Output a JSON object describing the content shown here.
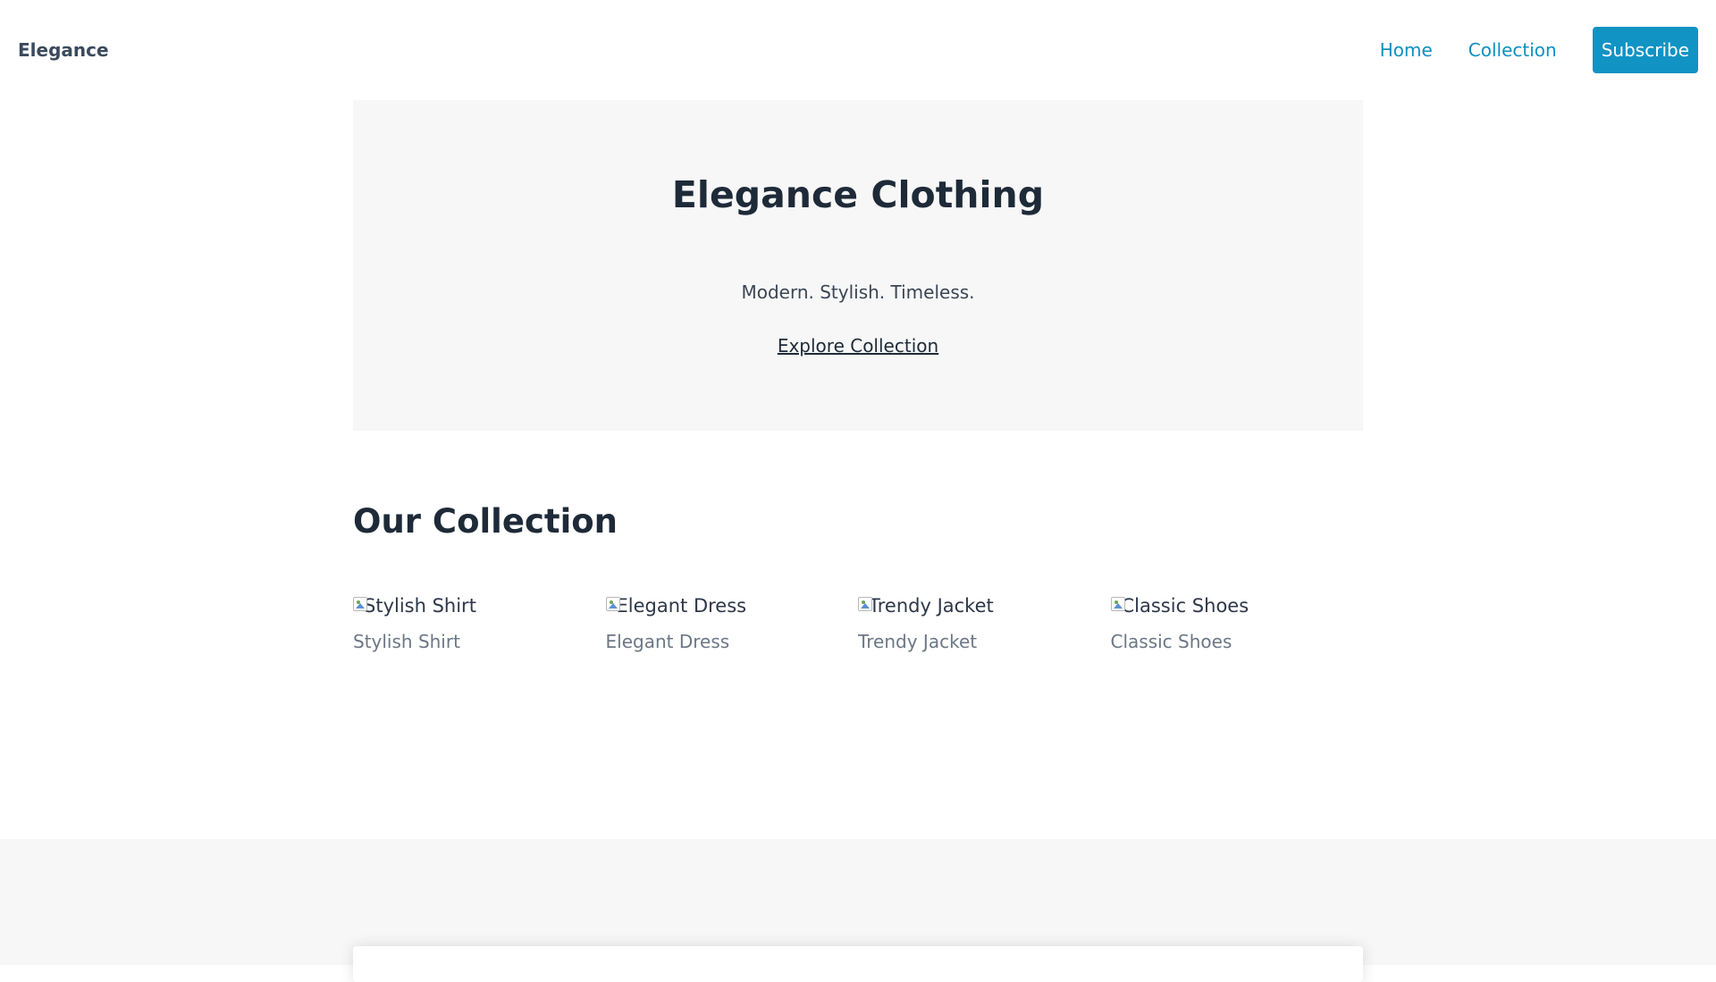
{
  "header": {
    "brand": "Elegance",
    "nav": {
      "home": "Home",
      "collection": "Collection",
      "subscribe": "Subscribe"
    }
  },
  "hero": {
    "title": "Elegance Clothing",
    "tagline": "Modern. Stylish. Timeless.",
    "cta": "Explore Collection"
  },
  "collection": {
    "title": "Our Collection",
    "products": [
      {
        "image_alt": "Stylish Shirt",
        "name": "Stylish Shirt"
      },
      {
        "image_alt": "Elegant Dress",
        "name": "Elegant Dress"
      },
      {
        "image_alt": "Trendy Jacket",
        "name": "Trendy Jacket"
      },
      {
        "image_alt": "Classic Shoes",
        "name": "Classic Shoes"
      }
    ]
  },
  "colors": {
    "accent": "#1193c4",
    "link": "#0e8fbf",
    "heading": "#1e2a38",
    "muted": "#6c7785",
    "hero_bg": "#f7f7f7"
  },
  "icons": {
    "product_image": "broken-image-icon"
  }
}
